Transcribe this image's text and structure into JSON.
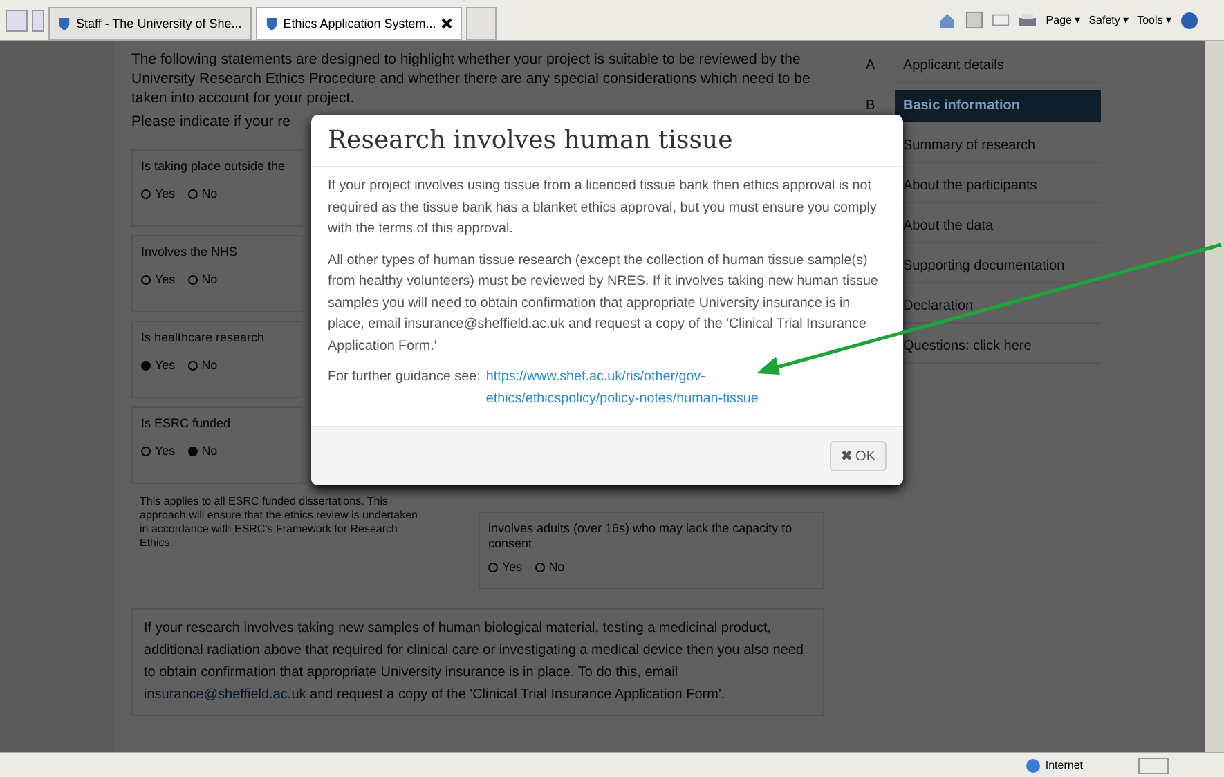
{
  "browser": {
    "tabs": [
      {
        "label": "Staff - The University of She...",
        "selected": false
      },
      {
        "label": "Ethics Application System...",
        "selected": true
      }
    ],
    "toolbar": [
      "Page ▾",
      "Safety ▾",
      "Tools ▾"
    ]
  },
  "page": {
    "intro": "The following statements are designed to highlight whether your project is suitable to be reviewed by the University Research Ethics Procedure and whether there are any special considerations which need to be taken into account for your project.",
    "prompt": "Please indicate if your re",
    "questions_left": [
      {
        "label": "Is taking place outside the",
        "options": [
          {
            "label": "Yes",
            "selected": false
          },
          {
            "label": "No",
            "selected": false
          }
        ]
      },
      {
        "label": "Involves the NHS",
        "options": [
          {
            "label": "Yes",
            "selected": false
          },
          {
            "label": "No",
            "selected": false
          }
        ]
      },
      {
        "label": "Is healthcare research",
        "options": [
          {
            "label": "Yes",
            "selected": true
          },
          {
            "label": "No",
            "selected": false
          }
        ]
      },
      {
        "label": "Is ESRC funded",
        "options": [
          {
            "label": "Yes",
            "selected": false
          },
          {
            "label": "No",
            "selected": true
          }
        ],
        "note": "This applies to all ESRC funded dissertations. This approach will ensure that the ethics review is undertaken in accordance with ESRC's Framework for Research Ethics."
      }
    ],
    "questions_right": [
      {
        "label": "involves adults (over 16s) who may lack the capacity to consent",
        "options": [
          {
            "label": "Yes",
            "selected": false
          },
          {
            "label": "No",
            "selected": false
          }
        ]
      }
    ],
    "insurance_note": {
      "before": "If your research involves taking new samples of human biological material, testing a medicinal product, additional radiation above that required for clinical care or investigating a medical device then you also need to obtain confirmation that appropriate University insurance is in place. To do this, email ",
      "link": "insurance@sheffield.ac.uk",
      "after": " and request a copy of the 'Clinical Trial Insurance Application Form'."
    }
  },
  "sidebar": {
    "items": [
      {
        "letter": "A",
        "label": "Applicant details",
        "selected": false
      },
      {
        "letter": "B",
        "label": "Basic information",
        "selected": true
      },
      {
        "label": "Summary of research",
        "selected": false
      },
      {
        "label": "About the participants",
        "selected": false
      },
      {
        "label": "About the data",
        "selected": false
      },
      {
        "label": "Supporting documentation",
        "selected": false
      },
      {
        "label": "Declaration",
        "selected": false
      },
      {
        "label": "Questions: click here",
        "selected": false
      }
    ]
  },
  "modal": {
    "title": "Research involves human tissue",
    "paragraphs": [
      "If your project involves using tissue from a licenced tissue bank then ethics approval is not required as the tissue bank has a blanket ethics approval, but you must ensure you comply with the terms of this approval.",
      "All other types of human tissue research (except the collection of human tissue sample(s) from healthy volunteers) must be reviewed by NRES. If it involves taking new human tissue samples you will need to obtain confirmation that appropriate University insurance is in place, email insurance@sheffield.ac.uk and request a copy of the 'Clinical Trial Insurance Application Form.'"
    ],
    "guidance_label": "For further guidance see:",
    "guidance_link": "https://www.shef.ac.uk/ris/other/gov-ethics/ethicspolicy/policy-notes/human-tissue",
    "ok_icon": "✖",
    "ok": "OK"
  },
  "status_bar": {
    "zone": "Internet"
  }
}
